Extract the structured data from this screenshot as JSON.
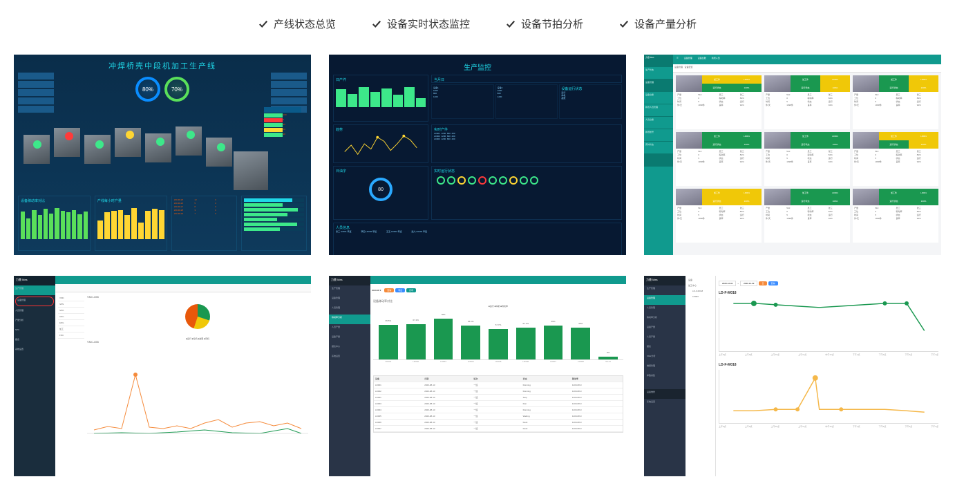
{
  "tabs": [
    {
      "label": "产线状态总览"
    },
    {
      "label": "设备实时状态监控"
    },
    {
      "label": "设备节拍分析"
    },
    {
      "label": "设备产量分析"
    }
  ],
  "thumb1": {
    "title": "冲焊桥壳中段机加工生产线",
    "ring1": "80%",
    "ring2": "70%",
    "panel1_title": "设备稼动率对比",
    "panel2_title": "产线每小时产量"
  },
  "thumb2": {
    "title": "生产监控",
    "ring_val": "80"
  },
  "thumb3": {
    "brand": "力鼎 Mes",
    "side_items": [
      "生产状态",
      "设备管理",
      "设备台账",
      "新增人员管理",
      "人员台账",
      "新增帐号",
      "实时状态"
    ],
    "cards": [
      {
        "head_colors": [
          "y",
          "y",
          "g",
          "g"
        ]
      },
      {
        "head_colors": [
          "g",
          "y",
          "g",
          "y"
        ]
      },
      {
        "head_colors": [
          "g",
          "y",
          "g",
          "y"
        ]
      },
      {
        "head_colors": [
          "g",
          "g",
          "g",
          "g"
        ]
      },
      {
        "head_colors": [
          "g",
          "g",
          "g",
          "g"
        ]
      },
      {
        "head_colors": [
          "y",
          "y",
          "g",
          "y"
        ]
      },
      {
        "head_colors": [
          "y",
          "y",
          "y",
          "y"
        ]
      },
      {
        "head_colors": [
          "g",
          "g",
          "g",
          "g"
        ]
      },
      {
        "head_colors": [
          "g",
          "g",
          "g",
          "g"
        ]
      }
    ]
  },
  "thumb4": {
    "brand": "力鼎 Mes",
    "device1": "VMC-855",
    "device2": "VMC-855"
  },
  "thumb5": {
    "brand": "力鼎 Mes",
    "chart_title": "设备稼动率对比",
    "legend": "■运行 ■停机 ■待机率",
    "table_headers": [
      "设备",
      "日期",
      "班次",
      "状态",
      "稼动率"
    ],
    "table_rows": [
      [
        "LD001",
        "2020-08-13",
        "一班",
        "Running",
        "1400-08-0"
      ],
      [
        "LD002",
        "2020-08-13",
        "一班",
        "Running",
        "1400-08-0"
      ],
      [
        "LD001",
        "2020-08-13",
        "一班",
        "Stop",
        "1400-08-0"
      ],
      [
        "LD003",
        "2020-08-13",
        "一班",
        "Run",
        "1400-08-0"
      ],
      [
        "LD004",
        "2020-08-13",
        "一班",
        "Running",
        "1400-08-0"
      ],
      [
        "LD005",
        "2020-08-13",
        "一班",
        "Waiting",
        "1400-08-0"
      ],
      [
        "LD006",
        "2020-08-13",
        "一班",
        "Fault",
        "1400-08-0"
      ],
      [
        "LD007",
        "2020-08-13",
        "一班",
        "Fault",
        "1400-08-0"
      ]
    ]
  },
  "thumb6": {
    "brand": "力鼎 Mes",
    "tree_items": [
      "设备",
      "加工中心",
      "LD-F-M018",
      "LD003"
    ],
    "date_from": "2020-12-02",
    "date_to": "2020-12-02",
    "chart1_title": "LD-F-M018",
    "chart2_title": "LD-F-M018",
    "x_labels": [
      "上午8点",
      "上午9点",
      "上午10点",
      "上午11点",
      "中午12点",
      "下午1点",
      "下午2点",
      "下午3点",
      "下午4点"
    ]
  },
  "chart_data": [
    {
      "id": "thumb1_panel1_bars",
      "type": "bar",
      "title": "设备稼动率对比",
      "values": [
        80,
        60,
        85,
        70,
        88,
        75,
        90,
        82,
        78,
        85,
        72,
        80
      ]
    },
    {
      "id": "thumb1_panel2_bars",
      "type": "bar",
      "title": "产线每小时产量",
      "values": [
        55,
        78,
        82,
        85,
        70,
        90,
        48,
        82,
        88,
        85
      ]
    },
    {
      "id": "thumb5_bars",
      "type": "bar",
      "title": "设备稼动率对比",
      "categories": [
        "LD001",
        "LD002",
        "LD003",
        "LD004",
        "LD005",
        "LD006",
        "LD007",
        "LD008",
        "06-21"
      ],
      "values_pct": [
        65.5,
        67.2,
        78.0,
        65.1,
        57.7,
        61.1,
        65.0,
        60.0,
        5.0
      ],
      "ylim": [
        0,
        100
      ]
    },
    {
      "id": "thumb6_chart1",
      "type": "line",
      "title": "LD-F-M018",
      "x": [
        "上午8点",
        "上午9点",
        "上午10点",
        "上午11点",
        "中午12点",
        "下午1点",
        "下午2点",
        "下午3点",
        "下午4点"
      ],
      "y": [
        100,
        100,
        98,
        96,
        95,
        96,
        98,
        100,
        60
      ],
      "ylim": [
        0,
        120
      ],
      "color": "#1a9850"
    },
    {
      "id": "thumb6_chart2",
      "type": "line",
      "title": "LD-F-M018",
      "x": [
        "上午8点",
        "上午9点",
        "上午10点",
        "上午11点",
        "中午12点",
        "下午1点",
        "下午2点",
        "下午3点",
        "下午4点"
      ],
      "y": [
        20,
        20,
        22,
        22,
        85,
        22,
        22,
        22,
        20
      ],
      "ylim": [
        0,
        100
      ],
      "color": "#f5b84a"
    }
  ]
}
